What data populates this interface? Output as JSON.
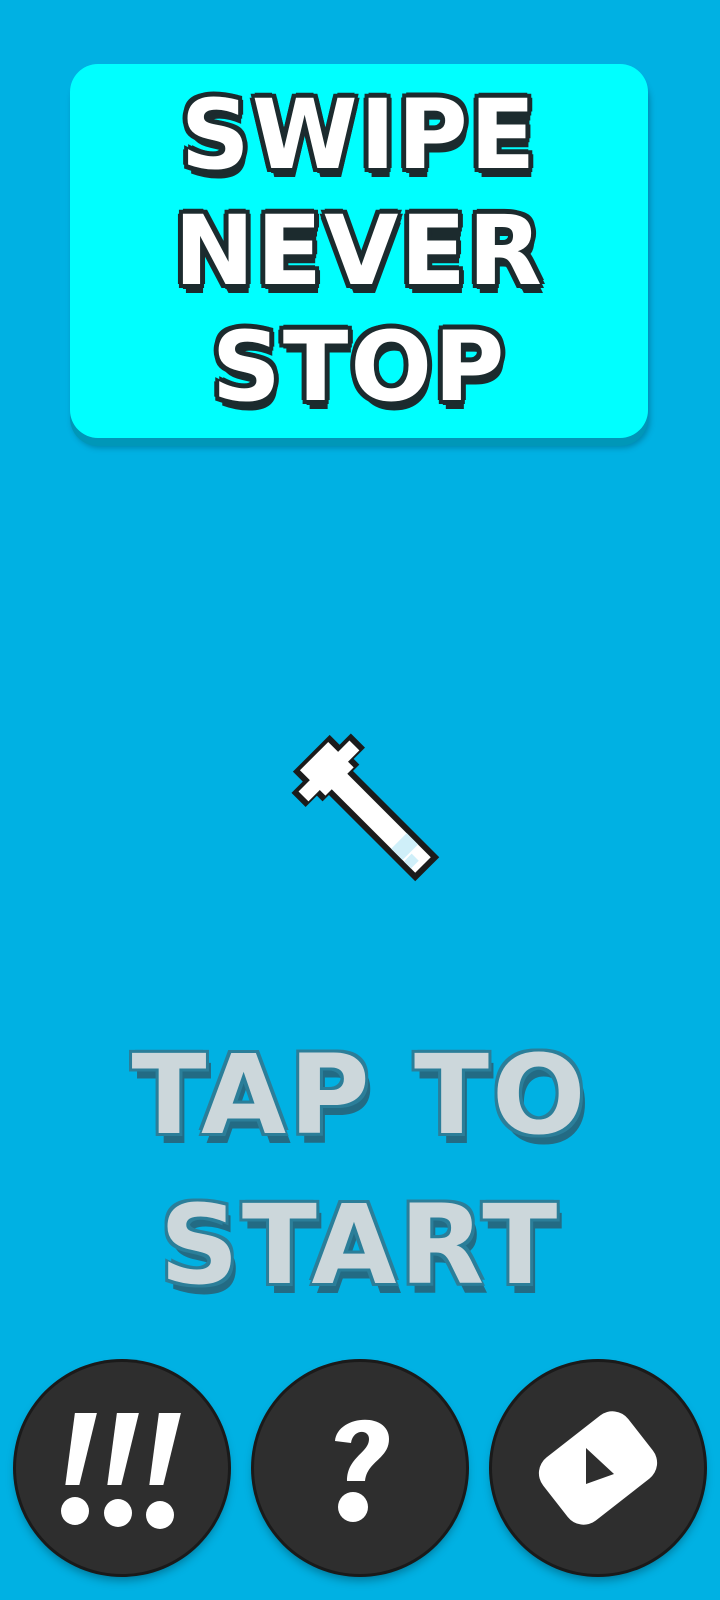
{
  "title": {
    "lines": [
      "SWIPE",
      "NEVER",
      "STOP"
    ]
  },
  "prompt": {
    "lines": [
      "TAP TO",
      "START"
    ]
  },
  "cursor": {
    "icon": "pixel-arrow-cursor-icon"
  },
  "buttons": [
    {
      "icon": "exclamations-icon",
      "label": "!!!"
    },
    {
      "icon": "question-icon",
      "label": "?"
    },
    {
      "icon": "video-play-icon",
      "label": "▶"
    }
  ],
  "colors": {
    "background": "#00b1e3",
    "title_box": "#00ffff",
    "button": "#2e2e2e",
    "prompt_text": "#ccd7db"
  }
}
